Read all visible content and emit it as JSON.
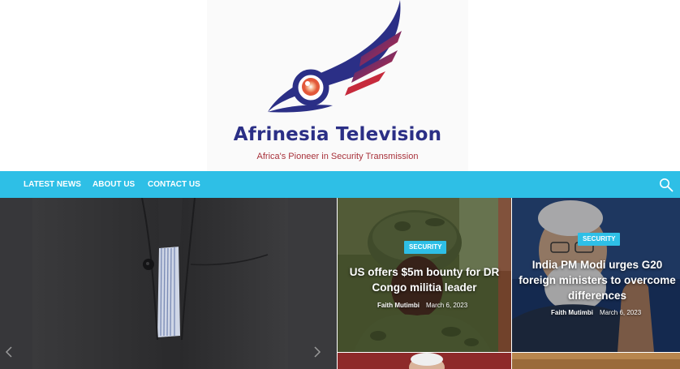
{
  "site": {
    "title": "Afrinesia Television",
    "tagline": "Africa's Pioneer in Security Transmission",
    "brand_colors": {
      "navy": "#2b2f86",
      "red": "#a8323b",
      "accent": "#2ebfe6"
    }
  },
  "nav": {
    "items": [
      {
        "label": "LATEST NEWS"
      },
      {
        "label": "ABOUT US"
      },
      {
        "label": "CONTACT US"
      }
    ],
    "search_icon": "search-icon"
  },
  "slider": {
    "prev_icon": "chevron-left-icon",
    "next_icon": "chevron-right-icon"
  },
  "cards": [
    {
      "category": "SECURITY",
      "title": "US offers $5m bounty for DR Congo militia leader",
      "author": "Faith Mutimbi",
      "date": "March 6, 2023"
    },
    {
      "category": "SECURITY",
      "title": "India PM Modi urges G20 foreign ministers to overcome differences",
      "author": "Faith Mutimbi",
      "date": "March 6, 2023"
    }
  ]
}
